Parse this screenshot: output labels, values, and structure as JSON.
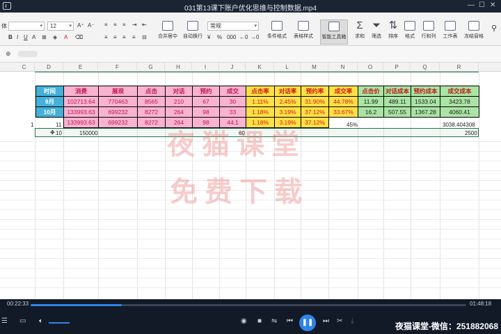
{
  "window": {
    "title": "031第13课下账户优化思维与控制数据.mp4"
  },
  "ribbon": {
    "font_size": "12",
    "number_format": "常规",
    "labels": {
      "merge": "合并居中",
      "wrap": "自动换行",
      "cond": "条件格式",
      "tablestyle": "表格样式",
      "smart": "智能工具箱",
      "sum": "求和",
      "filter": "筛选",
      "sort": "排序",
      "format": "格式",
      "rowcol": "行和列",
      "worksheet": "工作表",
      "freeze": "冻结窗格"
    },
    "font_side": "体"
  },
  "columns": [
    "C",
    "D",
    "E",
    "F",
    "G",
    "H",
    "I",
    "J",
    "K",
    "L",
    "M",
    "N",
    "O",
    "P",
    "Q",
    "R"
  ],
  "table": {
    "headers": [
      "时间",
      "消费",
      "展现",
      "点击",
      "对话",
      "预约",
      "成交",
      "点击率",
      "对话率",
      "预约率",
      "成交率",
      "点击价",
      "对话成本",
      "预约成本",
      "成交成本"
    ],
    "rows": [
      [
        "9月",
        "102713.64",
        "770463",
        "8565",
        "210",
        "67",
        "30",
        "1.11%",
        "2.45%",
        "31.90%",
        "44.78%",
        "11.99",
        "489.11",
        "1533.04",
        "3423.78"
      ],
      [
        "10月",
        "133993.63",
        "699232",
        "8272",
        "264",
        "98",
        "33",
        "1.18%",
        "3.19%",
        "37.12%",
        "33.67%",
        "16.2",
        "507.55",
        "1367.28",
        "4060.41"
      ],
      [
        "",
        "133993.63",
        "699232",
        "8272",
        "264",
        "98",
        "44.1",
        "1.18%",
        "3.19%",
        "37.12%",
        "",
        "",
        "",
        "",
        ""
      ]
    ]
  },
  "extra": {
    "row3_c": "1",
    "row3_d": "11",
    "row3_n": "45%",
    "row3_r": "3038.404308",
    "row4_d": "10",
    "row4_e": "150000",
    "row4_j": "60",
    "row4_r": "2500"
  },
  "watermark": {
    "line1": "夜猫课堂",
    "line2": "免费下载"
  },
  "player": {
    "elapsed": "00:22:33",
    "total": "01:48:18",
    "progress": 0.21,
    "credit": "夜猫课堂-微信：251882068"
  }
}
